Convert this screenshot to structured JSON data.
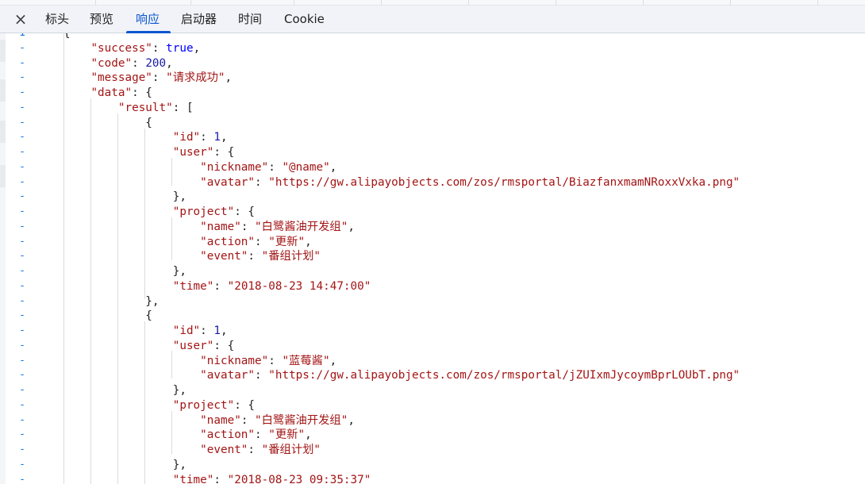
{
  "tabs": [
    {
      "label": "标头"
    },
    {
      "label": "预览"
    },
    {
      "label": "响应"
    },
    {
      "label": "启动器"
    },
    {
      "label": "时间"
    },
    {
      "label": "Cookie"
    }
  ],
  "active_tab": "响应",
  "close_icon": "×",
  "gutter_marker": "-",
  "first_line_number": "1",
  "response_json": {
    "success": "true",
    "code": "200",
    "message": "\"请求成功\"",
    "result": [
      {
        "id": "1",
        "nickname": "\"@name\"",
        "avatar": "\"https://gw.alipayobjects.com/zos/rmsportal/BiazfanxmamNRoxxVxka.png\"",
        "project_name": "\"白鹭酱油开发组\"",
        "action": "\"更新\"",
        "event": "\"番组计划\"",
        "time": "\"2018-08-23 14:47:00\""
      },
      {
        "id": "1",
        "nickname": "\"蓝莓酱\"",
        "avatar": "\"https://gw.alipayobjects.com/zos/rmsportal/jZUIxmJycoymBprLOUbT.png\"",
        "project_name": "\"白鹭酱油开发组\"",
        "action": "\"更新\"",
        "event": "\"番组计划\"",
        "time": "\"2018-08-23 09:35:37\""
      }
    ]
  }
}
